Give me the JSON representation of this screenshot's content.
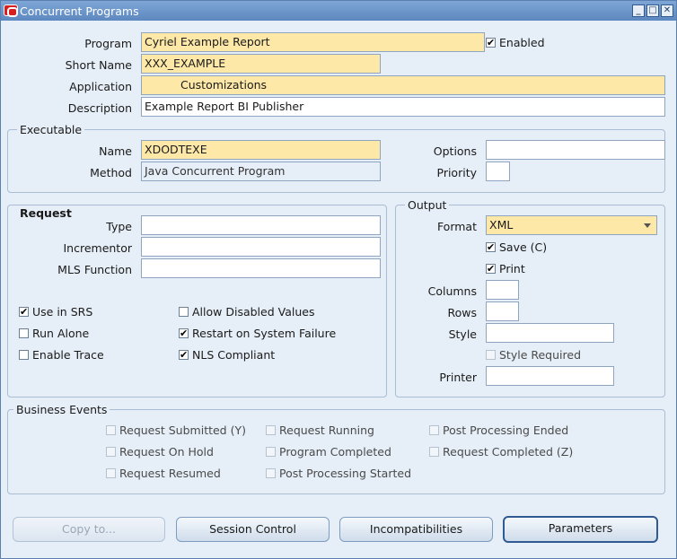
{
  "window": {
    "title": "Concurrent Programs"
  },
  "program": {
    "program_label": "Program",
    "program_value": "Cyriel Example Report",
    "enabled_label": "Enabled",
    "enabled_checked": true,
    "short_name_label": "Short Name",
    "short_name_value": "XXX_EXAMPLE",
    "application_label": "Application",
    "application_value": "Customizations",
    "description_label": "Description",
    "description_value": "Example Report BI Publisher"
  },
  "executable": {
    "title": "Executable",
    "name_label": "Name",
    "name_value": "XDODTEXE",
    "method_label": "Method",
    "method_value": "Java Concurrent Program",
    "options_label": "Options",
    "options_value": "",
    "priority_label": "Priority",
    "priority_value": ""
  },
  "request": {
    "title": "Request",
    "type_label": "Type",
    "type_value": "",
    "incrementor_label": "Incrementor",
    "incrementor_value": "",
    "mls_label": "MLS Function",
    "mls_value": "",
    "checkboxes": {
      "use_in_srs": {
        "label": "Use in SRS",
        "checked": true
      },
      "run_alone": {
        "label": "Run Alone",
        "checked": false
      },
      "enable_trace": {
        "label": "Enable Trace",
        "checked": false
      },
      "allow_disabled": {
        "label": "Allow Disabled Values",
        "checked": false
      },
      "restart_on_failure": {
        "label": "Restart on System Failure",
        "checked": true
      },
      "nls_compliant": {
        "label": "NLS Compliant",
        "checked": true
      }
    }
  },
  "output": {
    "title": "Output",
    "format_label": "Format",
    "format_value": "XML",
    "save_label": "Save (C)",
    "save_checked": true,
    "print_label": "Print",
    "print_checked": true,
    "columns_label": "Columns",
    "columns_value": "",
    "rows_label": "Rows",
    "rows_value": "",
    "style_label": "Style",
    "style_value": "",
    "style_required_label": "Style Required",
    "style_required_checked": false,
    "printer_label": "Printer",
    "printer_value": ""
  },
  "business_events": {
    "title": "Business Events",
    "items": {
      "request_submitted": "Request Submitted (Y)",
      "request_on_hold": "Request On Hold",
      "request_resumed": "Request Resumed",
      "request_running": "Request Running",
      "program_completed": "Program Completed",
      "post_processing_started": "Post Processing Started",
      "post_processing_ended": "Post Processing Ended",
      "request_completed": "Request Completed (Z)"
    }
  },
  "buttons": {
    "copy_to": "Copy to...",
    "session_control": "Session Control",
    "incompatibilities": "Incompatibilities",
    "parameters": "Parameters"
  },
  "colors": {
    "required_field": "#fde8a8",
    "window_bg": "#e6eef7",
    "titlebar": "#5d88c0"
  }
}
